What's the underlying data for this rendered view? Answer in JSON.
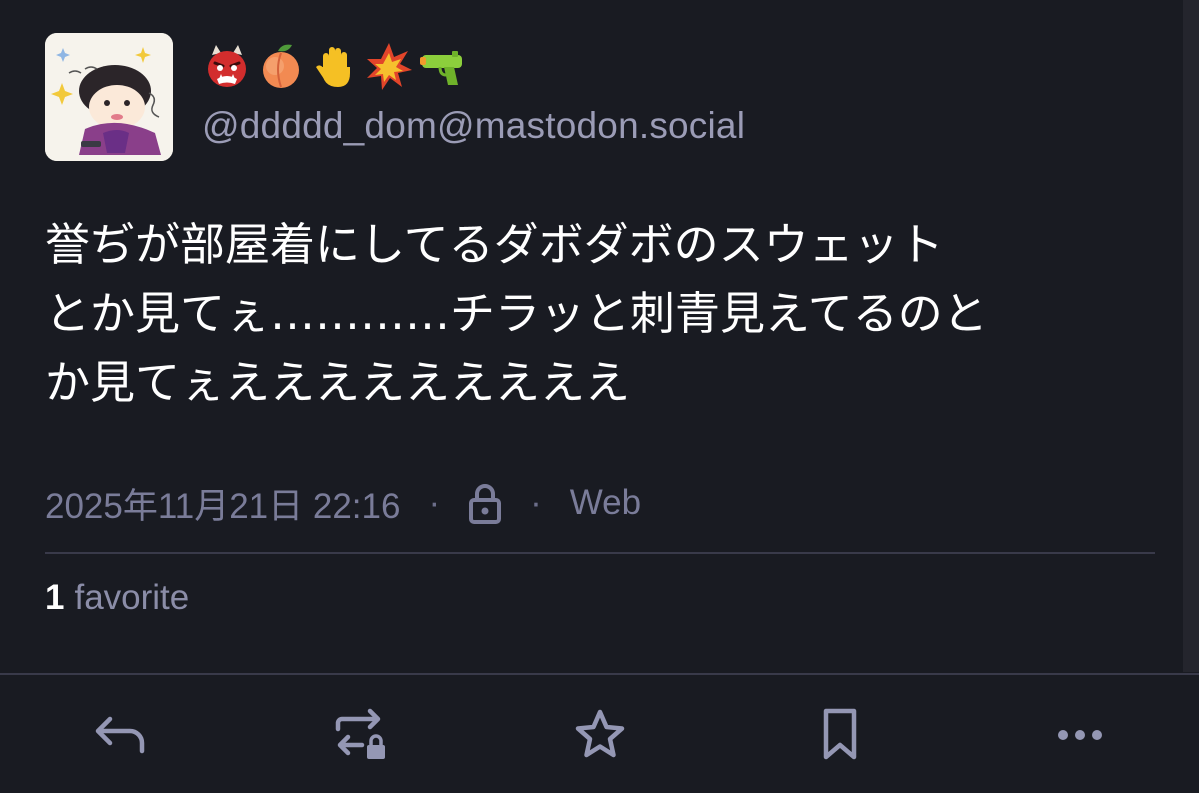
{
  "author": {
    "display_name_emojis": [
      "ogre-emoji",
      "peach-emoji",
      "raised-hand-emoji",
      "collision-emoji",
      "water-pistol-emoji"
    ],
    "handle": "@ddddd_dom@mastodon.social"
  },
  "status": {
    "lines": [
      "誉ぢが部屋着にしてるダボダボのスウェット",
      "とか見てぇ…………チラッと刺青見えてるのと",
      "か見てぇえええええええええ"
    ]
  },
  "meta": {
    "timestamp": "2025年11月21日 22:16",
    "separator": "·",
    "visibility_icon": "lock-icon",
    "application": "Web"
  },
  "stats": {
    "favorites_count": "1",
    "favorites_label": "favorite"
  },
  "actions": [
    {
      "name": "reply-icon"
    },
    {
      "name": "boost-locked-icon"
    },
    {
      "name": "favourite-star-icon"
    },
    {
      "name": "bookmark-icon"
    },
    {
      "name": "more-ellipsis-icon"
    }
  ],
  "colors": {
    "background": "#191b22",
    "text": "#ffffff",
    "secondary_text": "#9b9cb6",
    "divider": "#393a4a",
    "icon": "#9497b4"
  }
}
